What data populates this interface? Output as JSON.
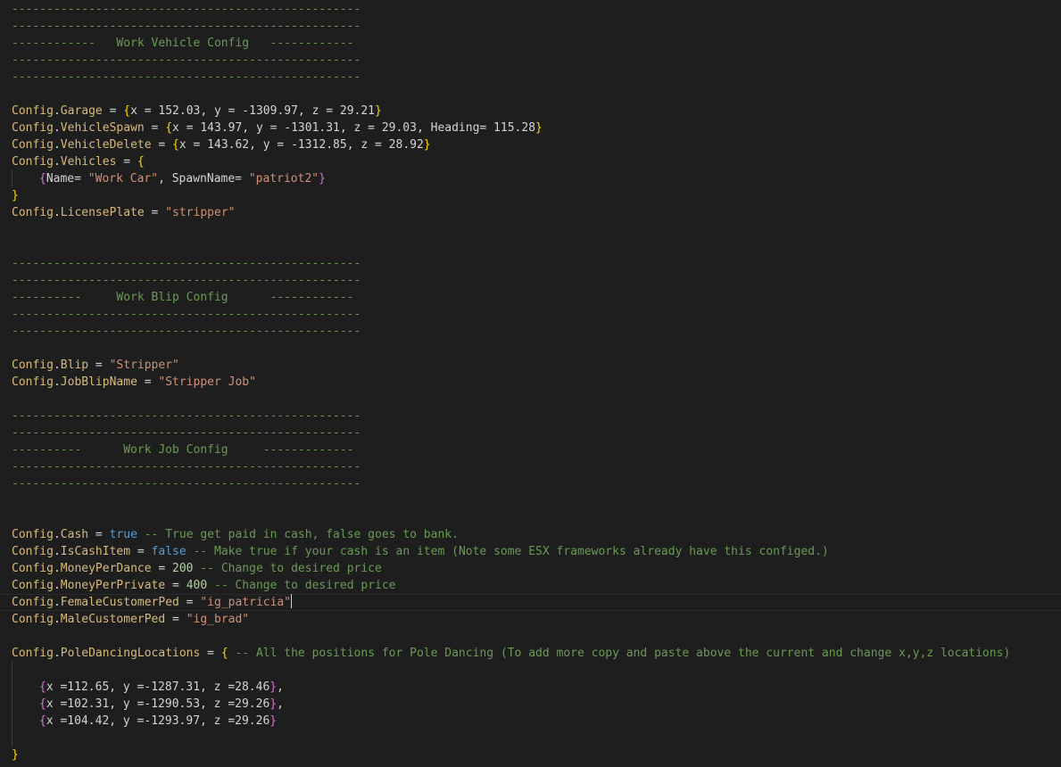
{
  "editor": {
    "dash_line": "--------------------------------------------------",
    "sections": {
      "vehicle_header": "------------   Work Vehicle Config   ------------",
      "blip_header": "----------     Work Blip Config      ------------",
      "job_header": "----------      Work Job Config     -------------"
    },
    "lines": {
      "garage": {
        "obj": "Config",
        "key": "Garage",
        "pre": " = ",
        "body": "x = 152.03, y = -1309.97, z = 29.21"
      },
      "vehicle_spawn": {
        "obj": "Config",
        "key": "VehicleSpawn",
        "pre": " = ",
        "body": "x = 143.97, y = -1301.31, z = 29.03, Heading= 115.28"
      },
      "vehicle_delete": {
        "obj": "Config",
        "key": "VehicleDelete",
        "pre": " = ",
        "body": "x = 143.62, y = -1312.85, z = 28.92"
      },
      "vehicles": {
        "obj": "Config",
        "key": "Vehicles",
        "pre": " = "
      },
      "vehicle_entry": {
        "name_key": "Name= ",
        "name_val": "\"Work Car\"",
        "sep": ", SpawnName= ",
        "spawn_val": "\"patriot2\""
      },
      "license_plate": {
        "obj": "Config",
        "key": "LicensePlate",
        "pre": " = ",
        "value": "\"stripper\""
      },
      "blip": {
        "obj": "Config",
        "key": "Blip",
        "pre": " = ",
        "value": "\"Stripper\""
      },
      "job_blip_name": {
        "obj": "Config",
        "key": "JobBlipName",
        "pre": " = ",
        "value": "\"Stripper Job\""
      },
      "cash": {
        "obj": "Config",
        "key": "Cash",
        "pre": " = ",
        "value": "true",
        "comment": " -- True get paid in cash, false goes to bank."
      },
      "is_cash_item": {
        "obj": "Config",
        "key": "IsCashItem",
        "pre": " = ",
        "value": "false",
        "comment": " -- Make true if your cash is an item (Note some ESX frameworks already have this configed.)"
      },
      "money_per_dance": {
        "obj": "Config",
        "key": "MoneyPerDance",
        "pre": " = ",
        "value": "200",
        "comment": " -- Change to desired price"
      },
      "money_per_private": {
        "obj": "Config",
        "key": "MoneyPerPrivate",
        "pre": " = ",
        "value": "400",
        "comment": " -- Change to desired price"
      },
      "female_customer_ped": {
        "obj": "Config",
        "key": "FemaleCustomerPed",
        "pre": " = ",
        "value": "\"ig_patricia\""
      },
      "male_customer_ped": {
        "obj": "Config",
        "key": "MaleCustomerPed",
        "pre": " = ",
        "value": "\"ig_brad\""
      },
      "pole_dancing_locations": {
        "obj": "Config",
        "key": "PoleDancingLocations",
        "pre": " = ",
        "comment": " -- All the positions for Pole Dancing (To add more copy and paste above the current and change x,y,z locations)"
      },
      "location_1": "x =112.65, y =-1287.31, z =28.46",
      "location_2": "x =102.31, y =-1290.53, z =29.26",
      "location_3": "x =104.42, y =-1293.97, z =29.26"
    },
    "punct": {
      "dot": ".",
      "open_brace": "{",
      "close_brace": "}",
      "comma": ","
    },
    "colors": {
      "background": "#1e1e1e",
      "comment": "#6a9955",
      "config_identifier": "#d7ba7d",
      "string": "#ce9178",
      "number": "#b5cea8",
      "boolean": "#569cd6",
      "bracket_level_1": "#ffd700",
      "bracket_level_2": "#da70d6"
    }
  }
}
